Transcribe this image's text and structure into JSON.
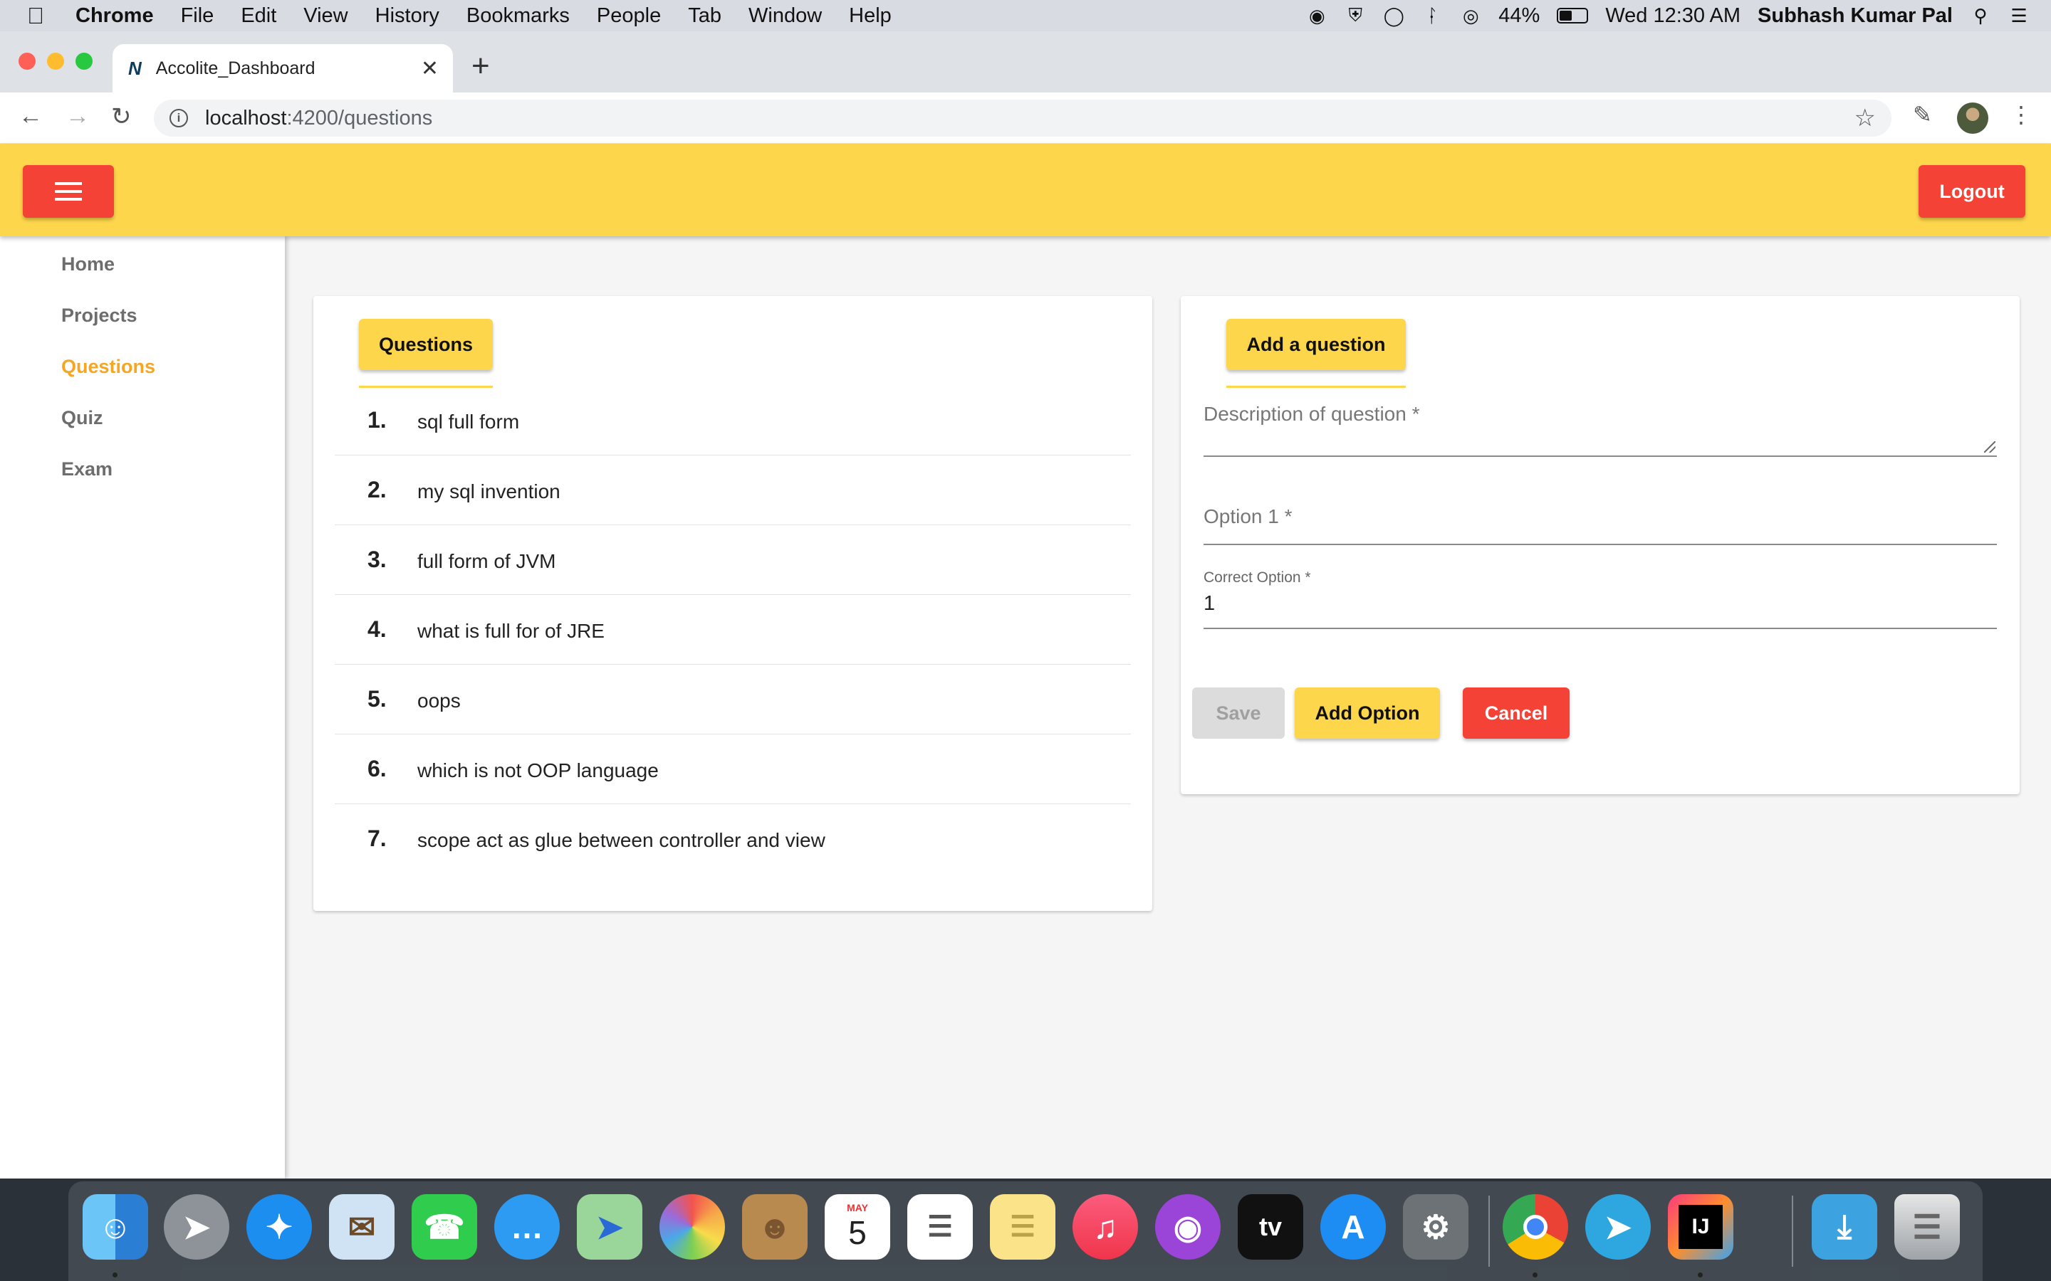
{
  "menubar": {
    "app_name": "Chrome",
    "menus": [
      "File",
      "Edit",
      "View",
      "History",
      "Bookmarks",
      "People",
      "Tab",
      "Window",
      "Help"
    ],
    "battery": "44%",
    "datetime": "Wed 12:30 AM",
    "user": "Subhash Kumar Pal"
  },
  "browser": {
    "tab_title": "Accolite_Dashboard",
    "favicon_text": "N",
    "url_host": "localhost",
    "url_path": ":4200/questions"
  },
  "header": {
    "logout_label": "Logout"
  },
  "sidebar": {
    "items": [
      {
        "label": "Home",
        "active": false
      },
      {
        "label": "Projects",
        "active": false
      },
      {
        "label": "Questions",
        "active": true
      },
      {
        "label": "Quiz",
        "active": false
      },
      {
        "label": "Exam",
        "active": false
      }
    ]
  },
  "questions_panel": {
    "tab_label": "Questions",
    "items": [
      {
        "num": "1.",
        "text": "sql full form"
      },
      {
        "num": "2.",
        "text": "my sql invention"
      },
      {
        "num": "3.",
        "text": "full form of JVM"
      },
      {
        "num": "4.",
        "text": "what is full for of JRE"
      },
      {
        "num": "5.",
        "text": "oops"
      },
      {
        "num": "6.",
        "text": "which is not OOP language"
      },
      {
        "num": "7.",
        "text": "scope act as glue between controller and view"
      }
    ]
  },
  "add_panel": {
    "tab_label": "Add a question",
    "description_placeholder": "Description of question *",
    "option1_placeholder": "Option 1 *",
    "correct_option_label": "Correct Option *",
    "correct_option_value": "1",
    "save_label": "Save",
    "add_option_label": "Add Option",
    "cancel_label": "Cancel"
  },
  "colors": {
    "header": "#fdd64c",
    "accent_red": "#f44336",
    "active_nav": "#f5a623"
  },
  "dock": {
    "calendar_month": "MAY",
    "calendar_day": "5",
    "tv_label": "tv",
    "ij_label": "IJ",
    "icons": [
      "finder-icon",
      "launchpad-icon",
      "safari-icon",
      "mail-icon",
      "facetime-icon",
      "messages-icon",
      "maps-icon",
      "photos-icon",
      "contacts-icon",
      "calendar-icon",
      "reminders-icon",
      "notes-icon",
      "music-icon",
      "podcasts-icon",
      "apple-tv-icon",
      "app-store-icon",
      "system-preferences-icon",
      "chrome-icon",
      "telegram-icon",
      "intellij-icon",
      "downloads-icon",
      "trash-icon"
    ]
  }
}
